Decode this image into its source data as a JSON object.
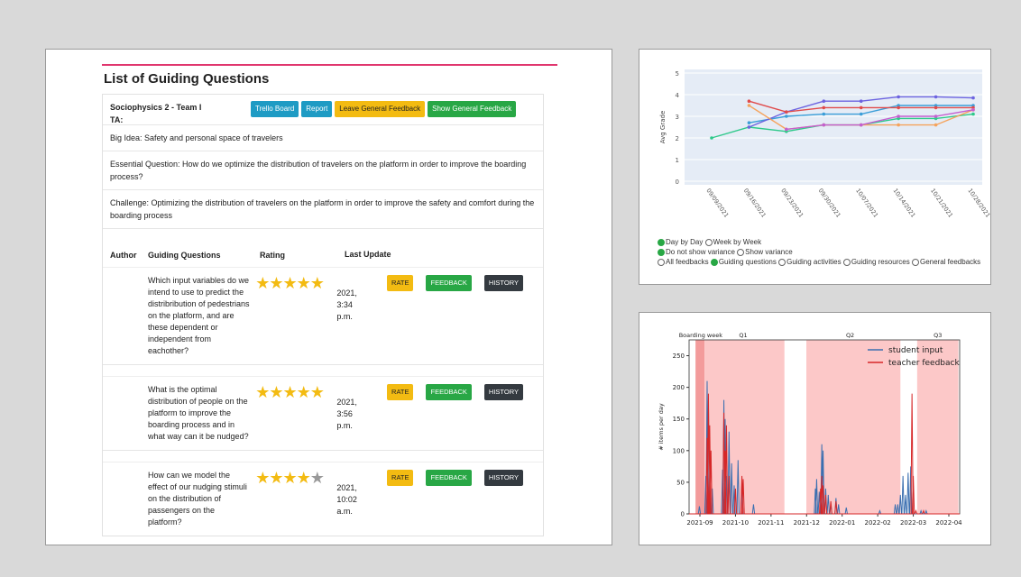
{
  "guiding": {
    "title": "List of Guiding Questions",
    "team": "Sociophysics 2 - Team I",
    "ta": "TA:",
    "buttons": {
      "trello": "Trello Board",
      "report": "Report",
      "leave": "Leave General Feedback",
      "show": "Show General Feedback"
    },
    "big_idea": "Big Idea: Safety and personal space of travelers",
    "essential": "Essential Question: How do we optimize the distribution of travelers on the platform in order to improve the boarding process?",
    "challenge": "Challenge: Optimizing the distribution of travelers on the platform in order to improve the safety and comfort during the boarding process",
    "columns": {
      "author": "Author",
      "questions": "Guiding Questions",
      "rating": "Rating",
      "update": "Last Update"
    },
    "actions": {
      "rate": "RATE",
      "feedback": "FEEDBACK",
      "history": "HISTORY"
    },
    "rows": [
      {
        "question": "Which input variables do we intend to use to predict the distribribution of pedestrians on the platform, and are these dependent or independent from eachother?",
        "stars": 5,
        "date": "2021,",
        "time": "3:34",
        "ampm": "p.m."
      },
      {
        "question": "What is the optimal distribution of people on the platform to improve the boarding process and in what way can it be nudged?",
        "stars": 5,
        "date": "2021,",
        "time": "3:56",
        "ampm": "p.m."
      },
      {
        "question": "How can we model the effect of our nudging stimuli on the distribution of passengers on the platform?",
        "stars": 4,
        "date": "2021,",
        "time": "10:02",
        "ampm": "a.m."
      }
    ]
  },
  "controls": {
    "line1": [
      "Day by Day",
      "Week by Week"
    ],
    "line2": [
      "Do not show variance",
      "Show variance"
    ],
    "line3": [
      "All feedbacks",
      "Guiding questions",
      "Guiding activities",
      "Guiding resources",
      "General feedbacks"
    ]
  },
  "chart_data": [
    {
      "type": "line",
      "ylabel": "Avg Grade",
      "ylim": [
        0,
        5
      ],
      "yticks": [
        "0",
        "1",
        "2",
        "3",
        "4",
        "5"
      ],
      "x": [
        "09/09/2021",
        "09/16/2021",
        "09/23/2021",
        "09/30/2021",
        "10/07/2021",
        "10/14/2021",
        "10/21/2021",
        "10/28/2021"
      ],
      "series": [
        {
          "color": "#2ec98a",
          "values": [
            2.0,
            2.5,
            2.3,
            2.6,
            2.6,
            2.9,
            2.9,
            3.1
          ]
        },
        {
          "color": "#3b9ed8",
          "values": [
            null,
            2.7,
            3.0,
            3.1,
            3.1,
            3.5,
            3.5,
            3.5
          ]
        },
        {
          "color": "#6c63e0",
          "values": [
            null,
            2.5,
            3.2,
            3.7,
            3.7,
            3.9,
            3.9,
            3.85
          ]
        },
        {
          "color": "#e04a4a",
          "values": [
            null,
            3.7,
            3.2,
            3.4,
            3.4,
            3.4,
            3.4,
            3.4
          ]
        },
        {
          "color": "#f5a35c",
          "values": [
            null,
            3.5,
            2.4,
            2.6,
            2.6,
            2.6,
            2.6,
            3.3
          ]
        },
        {
          "color": "#c45fd0",
          "values": [
            null,
            null,
            2.4,
            2.6,
            2.6,
            3.0,
            3.0,
            3.3
          ]
        }
      ]
    },
    {
      "type": "line",
      "ylabel": "# items per day",
      "ylim": [
        0,
        275
      ],
      "yticks": [
        "0",
        "50",
        "100",
        "150",
        "200",
        "250"
      ],
      "xticks": [
        "2021-09",
        "2021-10",
        "2021-11",
        "2021-12",
        "2022-01",
        "2022-02",
        "2022-03",
        "2022-04"
      ],
      "period_labels": [
        "Boarding week",
        "Q1",
        "Q2",
        "Q3"
      ],
      "legend": [
        "student input",
        "teacher feedback"
      ],
      "series_colors": {
        "student": "#3b6fb0",
        "teacher": "#d62728"
      },
      "student_spikes": [
        [
          8,
          12
        ],
        [
          13,
          60
        ],
        [
          14,
          210
        ],
        [
          15,
          180
        ],
        [
          18,
          40
        ],
        [
          26,
          70
        ],
        [
          27,
          180
        ],
        [
          28,
          150
        ],
        [
          29,
          60
        ],
        [
          31,
          130
        ],
        [
          33,
          80
        ],
        [
          35,
          45
        ],
        [
          38,
          85
        ],
        [
          41,
          50
        ],
        [
          50,
          15
        ],
        [
          98,
          40
        ],
        [
          99,
          55
        ],
        [
          101,
          35
        ],
        [
          103,
          110
        ],
        [
          104,
          100
        ],
        [
          106,
          40
        ],
        [
          108,
          30
        ],
        [
          110,
          15
        ],
        [
          114,
          25
        ],
        [
          116,
          15
        ],
        [
          122,
          10
        ],
        [
          148,
          5
        ],
        [
          160,
          15
        ],
        [
          162,
          15
        ],
        [
          164,
          30
        ],
        [
          166,
          60
        ],
        [
          168,
          30
        ],
        [
          170,
          65
        ],
        [
          172,
          75
        ],
        [
          180,
          5
        ],
        [
          184,
          5
        ]
      ],
      "teacher_spikes": [
        [
          14,
          120
        ],
        [
          15,
          190
        ],
        [
          16,
          140
        ],
        [
          17,
          100
        ],
        [
          27,
          160
        ],
        [
          28,
          100
        ],
        [
          29,
          140
        ],
        [
          31,
          60
        ],
        [
          36,
          40
        ],
        [
          41,
          60
        ],
        [
          42,
          55
        ],
        [
          102,
          40
        ],
        [
          103,
          60
        ],
        [
          104,
          45
        ],
        [
          106,
          30
        ],
        [
          110,
          20
        ],
        [
          114,
          20
        ],
        [
          173,
          190
        ],
        [
          174,
          60
        ],
        [
          176,
          5
        ],
        [
          182,
          5
        ]
      ],
      "days_total": 210,
      "bands": [
        [
          5,
          12,
          "#f39b9b"
        ],
        [
          12,
          74,
          "#fcc8c8"
        ],
        [
          91,
          164,
          "#fcc8c8"
        ],
        [
          177,
          209,
          "#fcc8c8"
        ]
      ]
    }
  ]
}
